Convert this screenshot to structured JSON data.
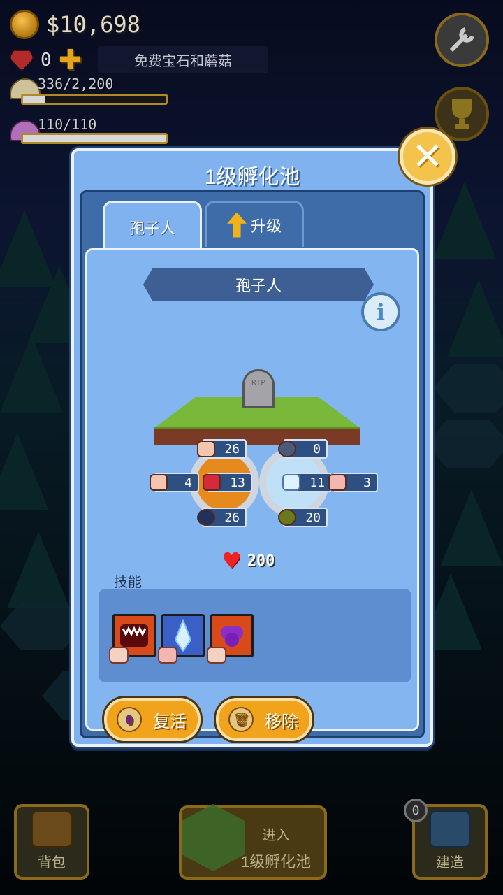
{
  "hud": {
    "money": "$10,698",
    "gems": "0",
    "promo": "免费宝石和蘑菇",
    "mushroom_bar": {
      "label": "336/2,200",
      "fill": 0.153
    },
    "purple_bar": {
      "label": "110/110",
      "fill": 1.0
    },
    "icons": [
      "coin-icon",
      "gem-icon",
      "plus-icon",
      "mushroom-icon",
      "purple-mushroom-icon",
      "wrench-icon",
      "trophy-icon"
    ]
  },
  "dialog": {
    "title": "1级孵化池",
    "close_icon": "close-icon",
    "tabs": [
      {
        "label": "孢子人",
        "active": true
      },
      {
        "label": "升级",
        "icon": "upgrade-arrow-icon",
        "active": false
      }
    ],
    "creature_name": "孢子人",
    "tombstone_text": "RIP",
    "stats": {
      "top_left": "26",
      "top_right": "0",
      "left": "4",
      "orange_center": "13",
      "blue_center": "11",
      "right": "3",
      "bottom_left": "26",
      "bottom_right": "20"
    },
    "hp": "200",
    "skills_label": "技能",
    "skills": [
      {
        "name": "mouth-skill",
        "color": "#d94a1a"
      },
      {
        "name": "ice-skill",
        "color": "#3a5fc6"
      },
      {
        "name": "purple-blob-skill",
        "color": "#d94a1a"
      }
    ],
    "buttons": {
      "revive": "复活",
      "remove": "移除"
    }
  },
  "bottom": {
    "backpack": "背包",
    "enter_line1": "进入",
    "enter_line2": "1级孵化池",
    "build": "建造",
    "build_count": "0"
  }
}
